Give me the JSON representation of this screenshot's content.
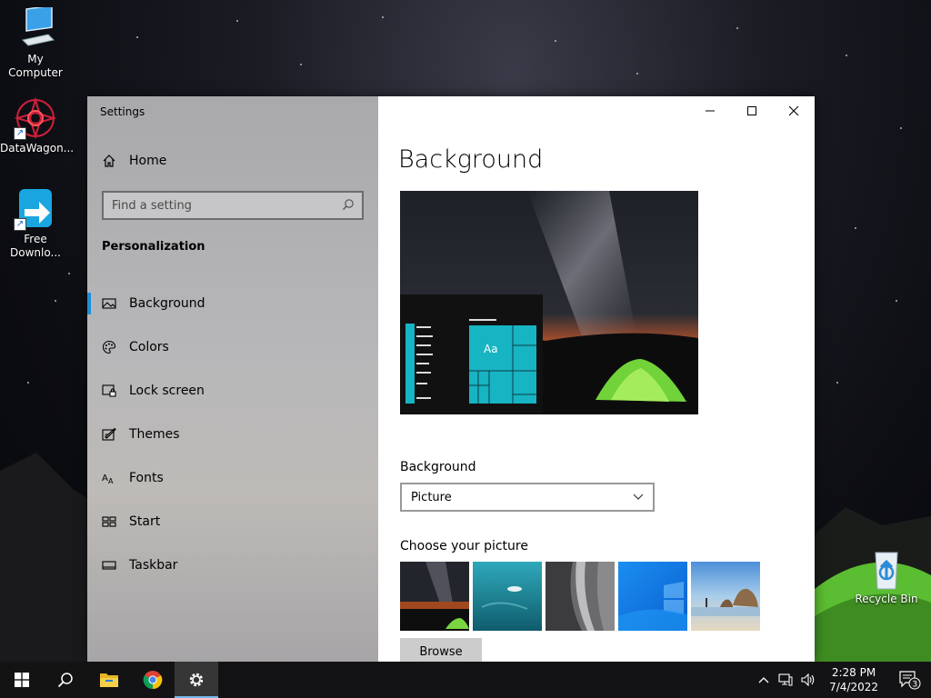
{
  "desktop": {
    "icons": [
      {
        "label": "My Computer"
      },
      {
        "label": "DataWagon..."
      },
      {
        "label": "Free Downlo..."
      },
      {
        "label": "Recycle Bin"
      }
    ]
  },
  "window": {
    "app_title": "Settings",
    "home_label": "Home",
    "search_placeholder": "Find a setting",
    "section_title": "Personalization",
    "nav": [
      {
        "label": "Background",
        "icon": "picture-icon",
        "active": true
      },
      {
        "label": "Colors",
        "icon": "palette-icon"
      },
      {
        "label": "Lock screen",
        "icon": "lock-screen-icon"
      },
      {
        "label": "Themes",
        "icon": "themes-icon"
      },
      {
        "label": "Fonts",
        "icon": "fonts-icon"
      },
      {
        "label": "Start",
        "icon": "start-icon"
      },
      {
        "label": "Taskbar",
        "icon": "taskbar-icon"
      }
    ],
    "controls": {
      "minimize": "minimize-icon",
      "maximize": "maximize-icon",
      "close": "close-icon"
    }
  },
  "main": {
    "page_title": "Background",
    "preview_tile_text": "Aa",
    "background_label": "Background",
    "background_value": "Picture",
    "choose_label": "Choose your picture",
    "thumbnails": [
      "night-sky-tent",
      "underwater-swimmer",
      "rock-cliff",
      "windows-blue",
      "beach-rocks"
    ],
    "browse_label": "Browse"
  },
  "taskbar": {
    "apps": [
      "start-icon",
      "search-icon",
      "file-explorer-icon",
      "chrome-icon",
      "settings-icon"
    ],
    "active_app": "settings-icon",
    "time": "2:28 PM",
    "date": "7/4/2022",
    "notification_count": "3"
  },
  "colors": {
    "accent": "#1f8fd6",
    "tile": "#17b4c3"
  }
}
